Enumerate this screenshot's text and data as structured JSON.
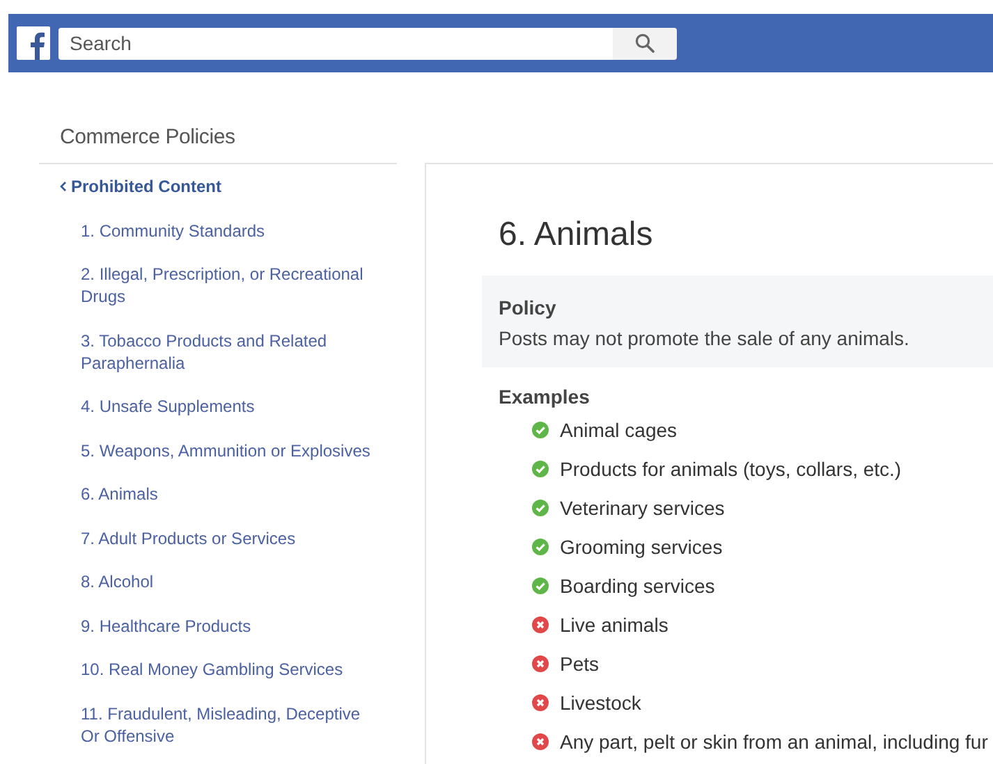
{
  "search": {
    "placeholder": "Search"
  },
  "sidebar": {
    "title": "Commerce Policies",
    "back_link": "Prohibited Content",
    "items": [
      "1. Community Standards",
      "2. Illegal, Prescription, or Recreational Drugs",
      "3. Tobacco Products and Related Paraphernalia",
      "4. Unsafe Supplements",
      "5. Weapons, Ammunition or Explosives",
      "6. Animals",
      "7. Adult Products or Services",
      "8. Alcohol",
      "9. Healthcare Products",
      "10. Real Money Gambling Services",
      "11. Fraudulent, Misleading, Deceptive Or Offensive"
    ]
  },
  "article": {
    "title": "6. Animals",
    "policy": {
      "heading": "Policy",
      "text": "Posts may not promote the sale of any animals."
    },
    "examples_heading": "Examples",
    "examples": [
      {
        "kind": "allowed",
        "text": "Animal cages"
      },
      {
        "kind": "allowed",
        "text": "Products for animals (toys, collars, etc.)"
      },
      {
        "kind": "allowed",
        "text": "Veterinary services"
      },
      {
        "kind": "allowed",
        "text": "Grooming services"
      },
      {
        "kind": "allowed",
        "text": "Boarding services"
      },
      {
        "kind": "prohibited",
        "text": "Live animals"
      },
      {
        "kind": "prohibited",
        "text": "Pets"
      },
      {
        "kind": "prohibited",
        "text": "Livestock"
      },
      {
        "kind": "prohibited",
        "text": "Any part, pelt or skin from an animal, including fur"
      }
    ]
  }
}
